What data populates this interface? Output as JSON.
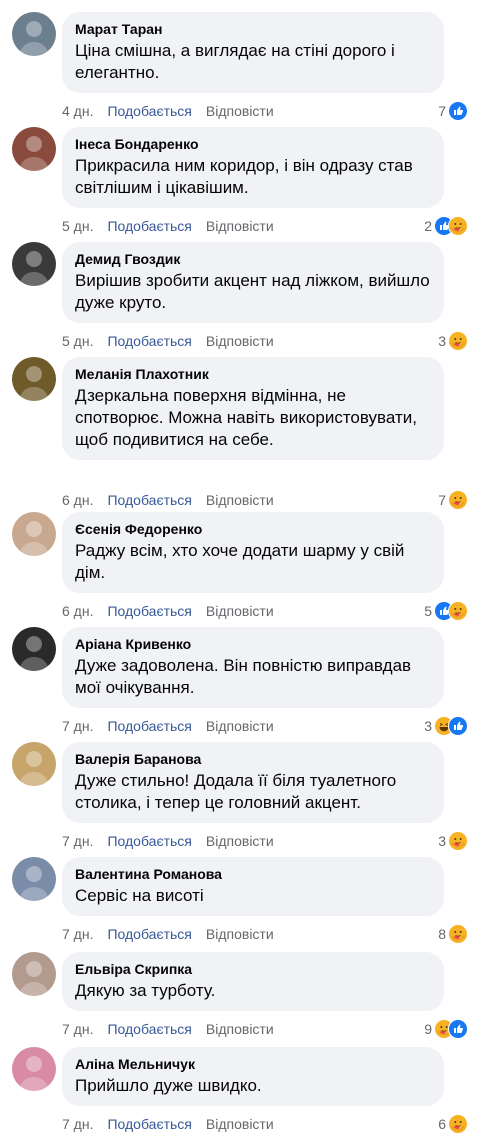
{
  "actions": {
    "like_label": "Подобається",
    "reply_label": "Відповісти"
  },
  "colors": {
    "bubble": "#f0f2f5",
    "like_link": "#385898",
    "meta": "#65676b",
    "like_reaction": "#1877f2",
    "care_reaction": "#f7b125"
  },
  "comments": [
    {
      "author": "Марат Таран",
      "text": "Ціна смішна, а виглядає на стіні дорого і елегантно.",
      "time": "4 дн.",
      "count": "7",
      "reactions": [
        "like-icon"
      ],
      "avatar_color": "#6b7f8f"
    },
    {
      "author": "Інеса Бондаренко",
      "text": "Прикрасила ним коридор, і він одразу став світлішим і цікавішим.",
      "time": "5 дн.",
      "count": "2",
      "reactions": [
        "like-icon",
        "care-icon"
      ],
      "avatar_color": "#8a4a3c"
    },
    {
      "author": "Демид Гвоздик",
      "text": "Вирішив зробити акцент над ліжком, вийшло дуже круто.",
      "time": "5 дн.",
      "count": "3",
      "reactions": [
        "care-icon"
      ],
      "avatar_color": "#3a3a3a"
    },
    {
      "author": "Меланія Плахотник",
      "text": "Дзеркальна поверхня відмінна, не спотворює. Можна навіть використовувати, щоб подивитися на себе.",
      "time": "6 дн.",
      "count": "7",
      "reactions": [
        "care-icon"
      ],
      "avatar_color": "#6f5a2a"
    },
    {
      "author": "Єсенія Федоренко",
      "text": "Раджу всім, хто хоче додати шарму у свій дім.",
      "time": "6 дн.",
      "count": "5",
      "reactions": [
        "like-icon",
        "care-icon"
      ],
      "avatar_color": "#c9a890"
    },
    {
      "author": "Аріана Кривенко",
      "text": "Дуже задоволена. Він повністю виправдав мої очікування.",
      "time": "7 дн.",
      "count": "3",
      "reactions": [
        "haha-icon",
        "like-icon"
      ],
      "avatar_color": "#2a2a2a"
    },
    {
      "author": "Валерія Баранова",
      "text": "Дуже стильно! Додала її біля туалетного столика, і тепер це головний акцент.",
      "time": "7 дн.",
      "count": "3",
      "reactions": [
        "care-icon"
      ],
      "avatar_color": "#c7a56a"
    },
    {
      "author": "Валентина Романова",
      "text": "Сервіс на висоті",
      "time": "7 дн.",
      "count": "8",
      "reactions": [
        "care-icon"
      ],
      "avatar_color": "#7a8ca8"
    },
    {
      "author": "Ельвіра Скрипка",
      "text": "Дякую за турботу.",
      "time": "7 дн.",
      "count": "9",
      "reactions": [
        "care-icon",
        "like-icon"
      ],
      "avatar_color": "#b39a8e"
    },
    {
      "author": "Аліна Мельничук",
      "text": "Прийшло дуже швидко.",
      "time": "7 дн.",
      "count": "6",
      "reactions": [
        "care-icon"
      ],
      "avatar_color": "#d98aa4"
    }
  ]
}
